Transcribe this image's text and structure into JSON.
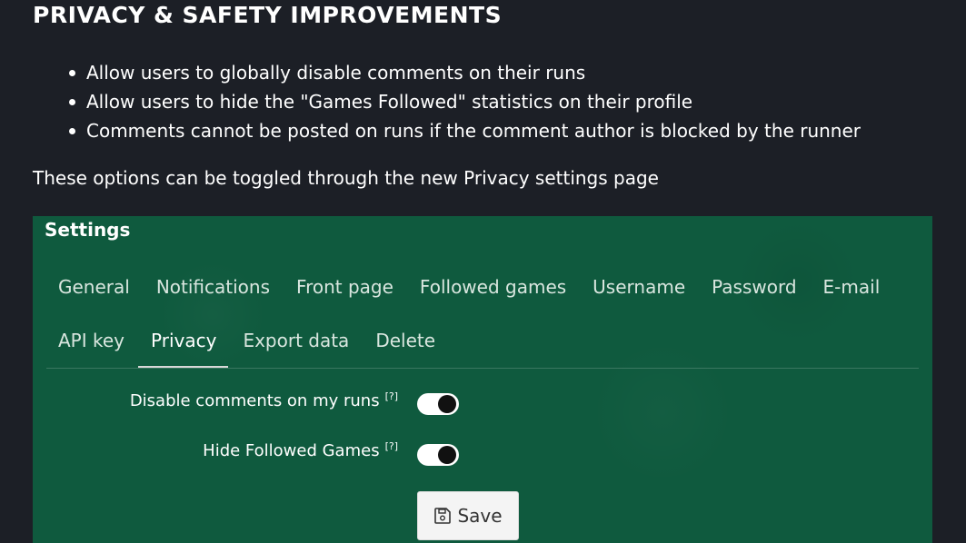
{
  "heading": "PRIVACY & SAFETY IMPROVEMENTS",
  "bullets": [
    "Allow users to globally disable comments on their runs",
    "Allow users to hide the \"Games Followed\" statistics on their profile",
    "Comments cannot be posted on runs if the comment author is blocked by the runner"
  ],
  "note": "These options can be toggled through the new Privacy settings page",
  "settings": {
    "title": "Settings",
    "tabs_row1": [
      "General",
      "Notifications",
      "Front page",
      "Followed games",
      "Username",
      "Password",
      "E-mail"
    ],
    "tabs_row2": [
      "API key",
      "Privacy",
      "Export data",
      "Delete"
    ],
    "active_tab": "Privacy",
    "options": [
      {
        "label": "Disable comments on my runs",
        "help": "[?]",
        "enabled": true
      },
      {
        "label": "Hide Followed Games",
        "help": "[?]",
        "enabled": true
      }
    ],
    "save_label": "Save"
  },
  "colors": {
    "page_bg": "#1c1f26",
    "panel_bg": "#0f5a3e",
    "toggle_on": "#ffffff",
    "button_bg": "#f4f4f4"
  },
  "icons": {
    "save": "floppy-disk-icon"
  }
}
